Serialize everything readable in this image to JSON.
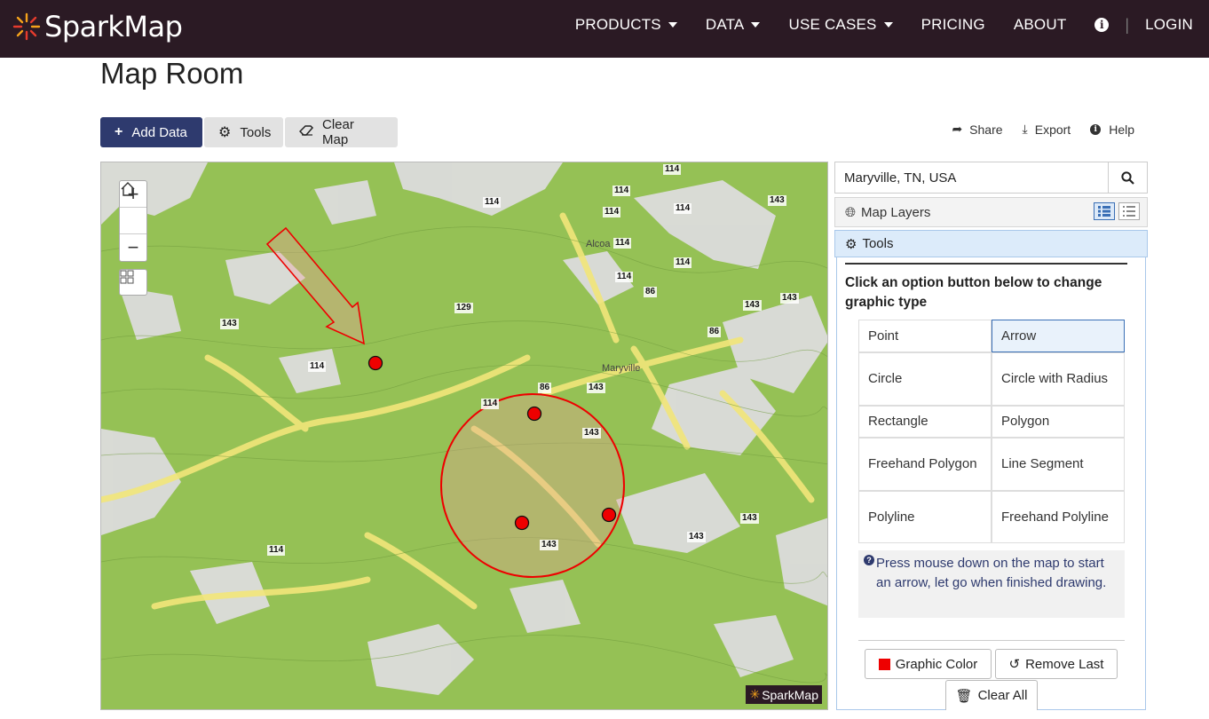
{
  "nav": {
    "brand": "SparkMap",
    "items": [
      {
        "label": "PRODUCTS",
        "dropdown": true
      },
      {
        "label": "DATA",
        "dropdown": true
      },
      {
        "label": "USE CASES",
        "dropdown": true
      },
      {
        "label": "PRICING",
        "dropdown": false
      },
      {
        "label": "ABOUT",
        "dropdown": false
      }
    ],
    "info_icon": "info-circle-icon",
    "login": "LOGIN"
  },
  "page": {
    "title": "Map Room"
  },
  "toolbar": {
    "add_data": "Add Data",
    "tools": "Tools",
    "clear_map": "Clear Map",
    "share": "Share",
    "export": "Export",
    "help": "Help"
  },
  "map": {
    "zoom_in": "+",
    "zoom_out": "−",
    "watermark": "SparkMap",
    "places": [
      "Alcoa",
      "Maryville"
    ],
    "road_labels": [
      "114",
      "114",
      "114",
      "114",
      "114",
      "114",
      "114",
      "114",
      "114",
      "114",
      "114",
      "143",
      "143",
      "143",
      "143",
      "143",
      "143",
      "143",
      "143",
      "86",
      "86",
      "86",
      "129",
      "143",
      "143"
    ]
  },
  "panel": {
    "search_value": "Maryville, TN, USA",
    "layers_title": "Map Layers",
    "tools_title": "Tools",
    "instruction": "Click an option button below to change graphic type",
    "options": [
      {
        "label": "Point",
        "selected": false
      },
      {
        "label": "Arrow",
        "selected": true
      },
      {
        "label": "Circle",
        "selected": false
      },
      {
        "label": "Circle with Radius",
        "selected": false
      },
      {
        "label": "Rectangle",
        "selected": false
      },
      {
        "label": "Polygon",
        "selected": false
      },
      {
        "label": "Freehand Polygon",
        "selected": false
      },
      {
        "label": "Line Segment",
        "selected": false
      },
      {
        "label": "Polyline",
        "selected": false
      },
      {
        "label": "Freehand Polyline",
        "selected": false
      }
    ],
    "help_text": "Press mouse down on the map to start an arrow, let go when finished drawing.",
    "graphic_color": "Graphic Color",
    "graphic_color_value": "#ee0000",
    "remove_last": "Remove Last",
    "clear_all": "Clear All"
  },
  "colors": {
    "nav_bg": "#2b1a24",
    "primary": "#2e3a6e",
    "map_green": "#95c155",
    "drawing": "#ee0000"
  }
}
